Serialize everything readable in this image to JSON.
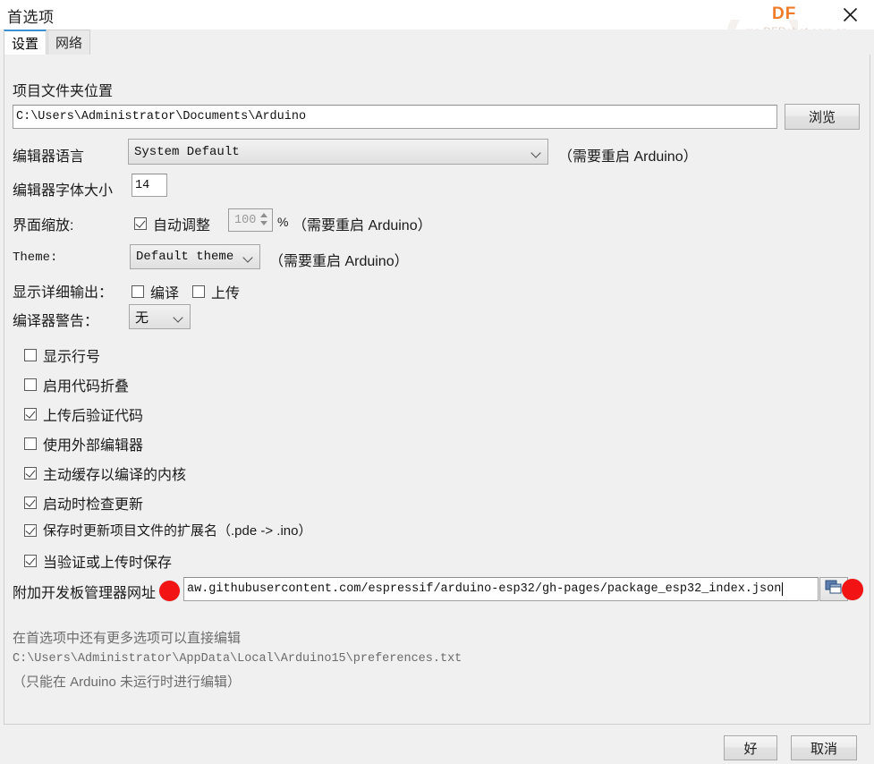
{
  "window": {
    "title": "首选项",
    "close_icon": "close-icon"
  },
  "watermark": {
    "logo": "DF",
    "site": "mc.DFRobot.com.cn"
  },
  "tabs": [
    {
      "label": "设置",
      "active": true
    },
    {
      "label": "网络",
      "active": false
    }
  ],
  "settings": {
    "sketchbook": {
      "label": "项目文件夹位置",
      "path": "C:\\Users\\Administrator\\Documents\\Arduino",
      "browse_label": "浏览"
    },
    "language": {
      "label": "编辑器语言",
      "value": "System Default",
      "note": "（需要重启 Arduino）"
    },
    "font_size": {
      "label": "编辑器字体大小",
      "value": "14"
    },
    "ui_scale": {
      "label": "界面缩放:",
      "auto_label": "自动调整",
      "auto_checked": true,
      "value": "100",
      "percent": "%",
      "note": "（需要重启 Arduino）"
    },
    "theme": {
      "label": "Theme:",
      "value": "Default theme",
      "note": "（需要重启 Arduino）"
    },
    "verbose": {
      "label": "显示详细输出：",
      "compile_label": "编译",
      "compile_checked": false,
      "upload_label": "上传",
      "upload_checked": false
    },
    "warnings": {
      "label": "编译器警告：",
      "value": "无"
    },
    "checkboxes": [
      {
        "label": "显示行号",
        "checked": false
      },
      {
        "label": "启用代码折叠",
        "checked": false
      },
      {
        "label": "上传后验证代码",
        "checked": true
      },
      {
        "label": "使用外部编辑器",
        "checked": false
      },
      {
        "label": "主动缓存以编译的内核",
        "checked": true
      },
      {
        "label": "启动时检查更新",
        "checked": true
      },
      {
        "label": "保存时更新项目文件的扩展名（.pde -> .ino）",
        "checked": true
      },
      {
        "label": "当验证或上传时保存",
        "checked": true
      }
    ],
    "board_urls": {
      "label": "附加开发板管理器网址",
      "value": "aw.githubusercontent.com/espressif/arduino-esp32/gh-pages/package_esp32_index.json",
      "expand_icon": "window-expand-icon"
    },
    "info": {
      "line1": "在首选项中还有更多选项可以直接编辑",
      "line2": "C:\\Users\\Administrator\\AppData\\Local\\Arduino15\\preferences.txt",
      "line3": "（只能在 Arduino 未运行时进行编辑）"
    }
  },
  "footer": {
    "ok_label": "好",
    "cancel_label": "取消"
  },
  "colors": {
    "accent": "#3c8fd0",
    "brand": "#ef7b29",
    "annotation": "#f21414"
  }
}
